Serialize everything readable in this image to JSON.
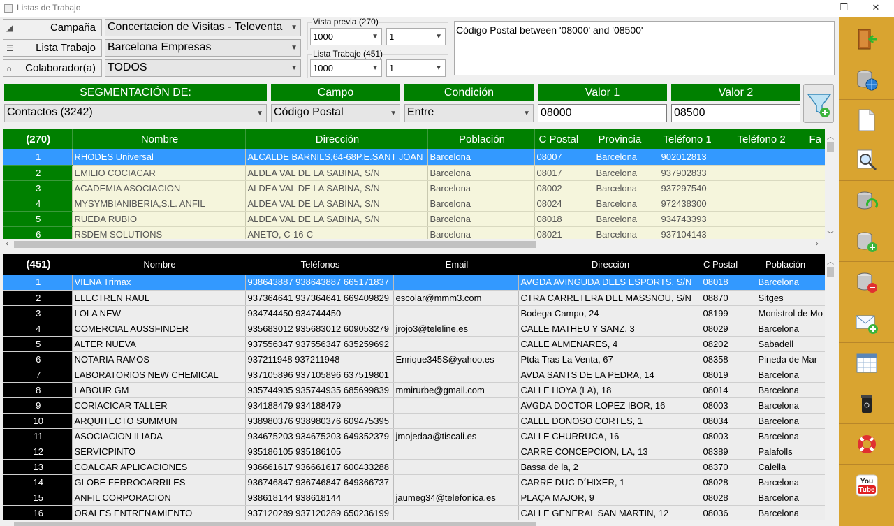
{
  "window": {
    "title": "Listas de Trabajo"
  },
  "selectors": {
    "campana": {
      "label": "Campaña",
      "value": "Concertacion de Visitas - Televenta"
    },
    "lista": {
      "label": "Lista Trabajo",
      "value": "Barcelona Empresas"
    },
    "colaborador": {
      "label": "Colaborador(a)",
      "value": "TODOS"
    }
  },
  "preview": {
    "vista_label": "Vista previa (270)",
    "vista_count": "1000",
    "vista_page": "1",
    "lista_label": "Lista Trabajo (451)",
    "lista_count": "1000",
    "lista_page": "1"
  },
  "filter_text": "Código Postal between '08000' and '08500'",
  "segmentation": {
    "header": "SEGMENTACIÓN DE:",
    "value": "Contactos (3242)",
    "campo_header": "Campo",
    "campo_value": "Código Postal",
    "condicion_header": "Condición",
    "condicion_value": "Entre",
    "valor1_header": "Valor 1",
    "valor1_value": "08000",
    "valor2_header": "Valor 2",
    "valor2_value": "08500"
  },
  "preview_grid": {
    "count": "(270)",
    "columns": [
      "Nombre",
      "Dirección",
      "Población",
      "C Postal",
      "Provincia",
      "Teléfono 1",
      "Teléfono 2",
      "Fa"
    ],
    "rows": [
      [
        "1",
        "RHODES Universal",
        "ALCALDE BARNILS,64-68P.E.SANT JOAN",
        "Barcelona",
        "08007",
        "Barcelona",
        "902012813",
        "",
        ""
      ],
      [
        "2",
        "EMILIO COCIACAR",
        "ALDEA VAL DE LA SABINA, S/N",
        "Barcelona",
        "08017",
        "Barcelona",
        "937902833",
        "",
        ""
      ],
      [
        "3",
        "ACADEMIA ASOCIACION",
        "ALDEA VAL DE LA SABINA, S/N",
        "Barcelona",
        "08002",
        "Barcelona",
        "937297540",
        "",
        ""
      ],
      [
        "4",
        "MYSYMBIANIBERIA,S.L. ANFIL",
        "ALDEA VAL DE LA SABINA, S/N",
        "Barcelona",
        "08024",
        "Barcelona",
        "972438300",
        "",
        ""
      ],
      [
        "5",
        "RUEDA RUBIO",
        "ALDEA VAL DE LA SABINA, S/N",
        "Barcelona",
        "08018",
        "Barcelona",
        "934743393",
        "",
        ""
      ],
      [
        "6",
        "RSDEM SOLUTIONS",
        "ANETO, C-16-C",
        "Barcelona",
        "08021",
        "Barcelona",
        "937104143",
        "",
        ""
      ]
    ]
  },
  "list_grid": {
    "count": "(451)",
    "columns": [
      "Nombre",
      "Teléfonos",
      "Email",
      "Dirección",
      "C Postal",
      "Población"
    ],
    "rows": [
      [
        "1",
        "VIENA Trimax",
        "938643887 938643887 665171837",
        "",
        "AVGDA AVINGUDA DELS ESPORTS, S/N",
        "08018",
        "Barcelona"
      ],
      [
        "2",
        "ELECTREN RAUL",
        "937364641 937364641 669409829",
        "escolar@mmm3.com",
        "CTRA CARRETERA DEL MASSNOU, S/N",
        "08870",
        "Sitges"
      ],
      [
        "3",
        "LOLA NEW",
        "934744450 934744450",
        "",
        "Bodega Campo, 24",
        "08199",
        "Monistrol de Mo"
      ],
      [
        "4",
        "COMERCIAL AUSSFINDER",
        "935683012 935683012 609053279",
        "jrojo3@teleline.es",
        "CALLE MATHEU Y SANZ, 3",
        "08029",
        "Barcelona"
      ],
      [
        "5",
        "ALTER NUEVA",
        "937556347 937556347 635259692",
        "",
        "CALLE ALMENARES, 4",
        "08202",
        "Sabadell"
      ],
      [
        "6",
        "NOTARIA RAMOS",
        "937211948 937211948",
        "Enrique345S@yahoo.es",
        "Ptda Tras La Venta, 67",
        "08358",
        "Pineda de Mar"
      ],
      [
        "7",
        "LABORATORIOS NEW CHEMICAL",
        "937105896 937105896 637519801",
        "",
        "AVDA SANTS DE LA PEDRA, 14",
        "08019",
        "Barcelona"
      ],
      [
        "8",
        "LABOUR GM",
        "935744935 935744935 685699839",
        "mmirurbe@gmail.com",
        "CALLE HOYA (LA), 18",
        "08014",
        "Barcelona"
      ],
      [
        "9",
        "CORIACICAR TALLER",
        "934188479 934188479",
        "",
        "AVGDA DOCTOR LOPEZ IBOR, 16",
        "08003",
        "Barcelona"
      ],
      [
        "10",
        "ARQUITECTO SUMMUN",
        "938980376 938980376 609475395",
        "",
        "CALLE DONOSO CORTES, 1",
        "08034",
        "Barcelona"
      ],
      [
        "11",
        "ASOCIACION ILIADA",
        "934675203 934675203 649352379",
        "jmojedaa@tiscali.es",
        "CALLE CHURRUCA, 16",
        "08003",
        "Barcelona"
      ],
      [
        "12",
        "SERVICPINTO",
        "935186105 935186105",
        "",
        "CARRE CONCEPCION, LA, 13",
        "08389",
        "Palafolls"
      ],
      [
        "13",
        "COALCAR APLICACIONES",
        "936661617 936661617 600433288",
        "",
        "Bassa de la, 2",
        "08370",
        "Calella"
      ],
      [
        "14",
        "GLOBE FERROCARRILES",
        "936746847 936746847 649366737",
        "",
        "CARRE DUC D´HIXER, 1",
        "08028",
        "Barcelona"
      ],
      [
        "15",
        "ANFIL CORPORACION",
        "938618144 938618144",
        "jaumeg34@telefonica.es",
        "PLAÇA MAJOR, 9",
        "08028",
        "Barcelona"
      ],
      [
        "16",
        "ORALES ENTRENAMIENTO",
        "937120289 937120289 650236199",
        "",
        "CALLE GENERAL SAN MARTIN, 12",
        "08036",
        "Barcelona"
      ]
    ]
  },
  "sidebar": {
    "buttons": [
      "exit-door-icon",
      "database-globe-icon",
      "new-document-icon",
      "search-magnifier-icon",
      "database-refresh-icon",
      "database-add-icon",
      "database-remove-icon",
      "email-add-icon",
      "calendar-grid-icon",
      "recycle-bin-icon",
      "lifebuoy-help-icon",
      "youtube-icon"
    ],
    "youtube_line1": "You",
    "youtube_line2": "Tube"
  },
  "colors": {
    "green": "#008000",
    "selected": "#3399ff",
    "sidebar": "#d9a430",
    "cream": "#f5f5dc"
  }
}
